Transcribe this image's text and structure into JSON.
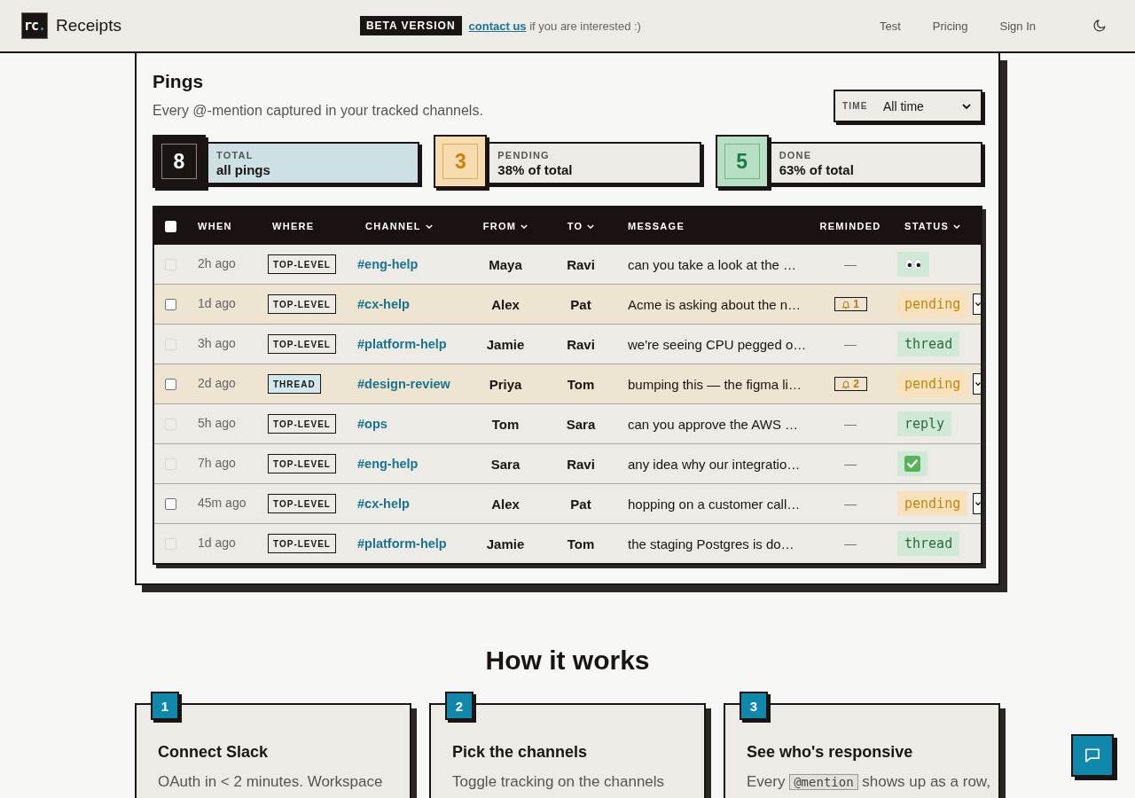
{
  "header": {
    "logo": {
      "text": "rc",
      "accent": "."
    },
    "brand": "Receipts",
    "beta_badge": "BETA VERSION",
    "beta_link": "contact us",
    "beta_note": "if you are interested :)",
    "nav": [
      "Test",
      "Pricing",
      "Sign In"
    ]
  },
  "pings": {
    "title": "Pings",
    "subtitle": "Every @-mention captured in your tracked channels.",
    "filter": {
      "label": "TIME",
      "value": "All time"
    },
    "stats": [
      {
        "kind": "total",
        "count": "8",
        "title": "TOTAL",
        "caption": "all pings"
      },
      {
        "kind": "pending",
        "count": "3",
        "title": "PENDING",
        "caption": "38% of total"
      },
      {
        "kind": "done",
        "count": "5",
        "title": "DONE",
        "caption": "63% of total"
      }
    ],
    "table": {
      "select_all": {
        "checked": false
      },
      "columns": [
        {
          "label": "WHEN",
          "sortable": false
        },
        {
          "label": "WHERE",
          "sortable": false
        },
        {
          "label": "CHANNEL",
          "sortable": true
        },
        {
          "label": "FROM",
          "sortable": true
        },
        {
          "label": "TO",
          "sortable": true
        },
        {
          "label": "MESSAGE",
          "sortable": false
        },
        {
          "label": "REMINDED",
          "sortable": false
        },
        {
          "label": "STATUS",
          "sortable": true
        }
      ],
      "rows": [
        {
          "highlighted": false,
          "checked": false,
          "checkbox_disabled": true,
          "when": "2h ago",
          "where": {
            "kind": "top_level",
            "label": "TOP-LEVEL"
          },
          "channel": "#eng-help",
          "from": "Maya",
          "to": "Ravi",
          "message": "can you take a look at the …",
          "reminded": {
            "kind": "none",
            "text": "—"
          },
          "status": {
            "kind": "eyes",
            "pending": false
          },
          "menu_button": false
        },
        {
          "highlighted": true,
          "checked": false,
          "checkbox_disabled": false,
          "when": "1d ago",
          "where": {
            "kind": "top_level",
            "label": "TOP-LEVEL"
          },
          "channel": "#cx-help",
          "from": "Alex",
          "to": "Pat",
          "message": "Acme is asking about the n…",
          "reminded": {
            "kind": "bell",
            "text": "1"
          },
          "status": {
            "kind": "text",
            "pending": true,
            "label": "pending"
          },
          "menu_button": true
        },
        {
          "highlighted": false,
          "checked": false,
          "checkbox_disabled": true,
          "when": "3h ago",
          "where": {
            "kind": "top_level",
            "label": "TOP-LEVEL"
          },
          "channel": "#platform-help",
          "from": "Jamie",
          "to": "Ravi",
          "message": "we're seeing CPU pegged o…",
          "reminded": {
            "kind": "none",
            "text": "—"
          },
          "status": {
            "kind": "text",
            "pending": false,
            "label": "thread"
          },
          "menu_button": false
        },
        {
          "highlighted": true,
          "checked": false,
          "checkbox_disabled": false,
          "when": "2d ago",
          "where": {
            "kind": "thread",
            "label": "THREAD"
          },
          "channel": "#design-review",
          "from": "Priya",
          "to": "Tom",
          "message": "bumping this — the figma li…",
          "reminded": {
            "kind": "bell",
            "text": "2"
          },
          "status": {
            "kind": "text",
            "pending": true,
            "label": "pending"
          },
          "menu_button": true
        },
        {
          "highlighted": false,
          "checked": false,
          "checkbox_disabled": true,
          "when": "5h ago",
          "where": {
            "kind": "top_level",
            "label": "TOP-LEVEL"
          },
          "channel": "#ops",
          "from": "Tom",
          "to": "Sara",
          "message": "can you approve the AWS …",
          "reminded": {
            "kind": "none",
            "text": "—"
          },
          "status": {
            "kind": "text",
            "pending": false,
            "label": "reply"
          },
          "menu_button": false
        },
        {
          "highlighted": false,
          "checked": false,
          "checkbox_disabled": true,
          "when": "7h ago",
          "where": {
            "kind": "top_level",
            "label": "TOP-LEVEL"
          },
          "channel": "#eng-help",
          "from": "Sara",
          "to": "Ravi",
          "message": "any idea why our integratio…",
          "reminded": {
            "kind": "none",
            "text": "—"
          },
          "status": {
            "kind": "check",
            "pending": false
          },
          "menu_button": false
        },
        {
          "highlighted": false,
          "checked": false,
          "checkbox_disabled": false,
          "when": "45m ago",
          "where": {
            "kind": "top_level",
            "label": "TOP-LEVEL"
          },
          "channel": "#cx-help",
          "from": "Alex",
          "to": "Pat",
          "message": "hopping on a customer call…",
          "reminded": {
            "kind": "none",
            "text": "—"
          },
          "status": {
            "kind": "text",
            "pending": true,
            "label": "pending"
          },
          "menu_button": true
        },
        {
          "highlighted": false,
          "checked": false,
          "checkbox_disabled": true,
          "when": "1d ago",
          "where": {
            "kind": "top_level",
            "label": "TOP-LEVEL"
          },
          "channel": "#platform-help",
          "from": "Jamie",
          "to": "Tom",
          "message": "the staging Postgres is do…",
          "reminded": {
            "kind": "none",
            "text": "—"
          },
          "status": {
            "kind": "text",
            "pending": false,
            "label": "thread"
          },
          "menu_button": false
        }
      ]
    }
  },
  "how_it_works": {
    "title": "How it works",
    "steps": [
      {
        "number": "1",
        "title": "Connect Slack",
        "text": [
          {
            "kind": "text",
            "text": "OAuth in < 2 minutes. Workspace"
          }
        ]
      },
      {
        "number": "2",
        "title": "Pick the channels",
        "text": [
          {
            "kind": "text",
            "text": "Toggle tracking on the channels"
          }
        ]
      },
      {
        "number": "3",
        "title": "See who's responsive",
        "text": [
          {
            "kind": "text",
            "text": "Every "
          },
          {
            "kind": "code",
            "text": "@mention"
          },
          {
            "kind": "text",
            "text": " shows up as a row,"
          }
        ]
      }
    ]
  }
}
